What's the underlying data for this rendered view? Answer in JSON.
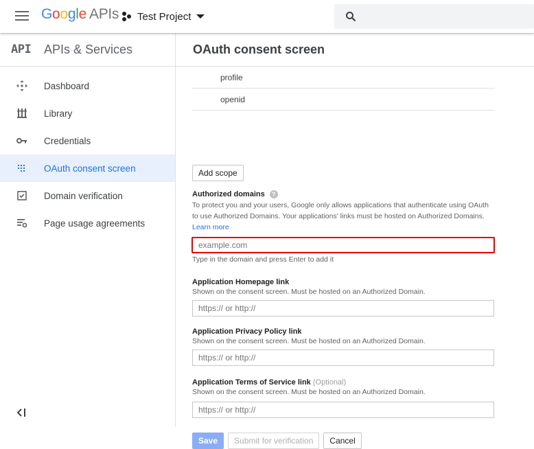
{
  "topbar": {
    "logo_letters": [
      "G",
      "o",
      "o",
      "g",
      "l",
      "e"
    ],
    "logo_suffix": "APIs",
    "project_name": "Test Project",
    "icons": [
      "hamburger-menu-icon",
      "project-icon",
      "caret-down-icon",
      "search-icon"
    ]
  },
  "sidebar": {
    "mark": "API",
    "title": "APIs & Services",
    "items": [
      {
        "label": "Dashboard",
        "icon": "dashboard-icon",
        "active": false
      },
      {
        "label": "Library",
        "icon": "library-icon",
        "active": false
      },
      {
        "label": "Credentials",
        "icon": "key-icon",
        "active": false
      },
      {
        "label": "OAuth consent screen",
        "icon": "oauth-icon",
        "active": true
      },
      {
        "label": "Domain verification",
        "icon": "checkbox-icon",
        "active": false
      },
      {
        "label": "Page usage agreements",
        "icon": "settings-list-icon",
        "active": false
      }
    ]
  },
  "main": {
    "title": "OAuth consent screen",
    "scopes": [
      "profile",
      "openid"
    ],
    "add_scope_label": "Add scope",
    "authorized_domains": {
      "label": "Authorized domains",
      "help": "?",
      "desc": "To protect you and your users, Google only allows applications that authenticate using OAuth to use Authorized Domains. Your applications' links must be hosted on Authorized Domains.",
      "learn_more": "Learn more",
      "placeholder": "example.com",
      "hint": "Type in the domain and press Enter to add it"
    },
    "homepage": {
      "label": "Application Homepage link",
      "desc": "Shown on the consent screen. Must be hosted on an Authorized Domain.",
      "placeholder": "https:// or http://"
    },
    "privacy": {
      "label": "Application Privacy Policy link",
      "desc": "Shown on the consent screen. Must be hosted on an Authorized Domain.",
      "placeholder": "https:// or http://"
    },
    "terms": {
      "label": "Application Terms of Service link",
      "optional": "(Optional)",
      "desc": "Shown on the consent screen. Must be hosted on an Authorized Domain.",
      "placeholder": "https:// or http://"
    },
    "actions": {
      "save": "Save",
      "submit": "Submit for verification",
      "cancel": "Cancel"
    }
  },
  "colors": {
    "accent": "#1a73e8",
    "active_bg": "#e8f0fe",
    "highlight_border": "#e50000"
  }
}
